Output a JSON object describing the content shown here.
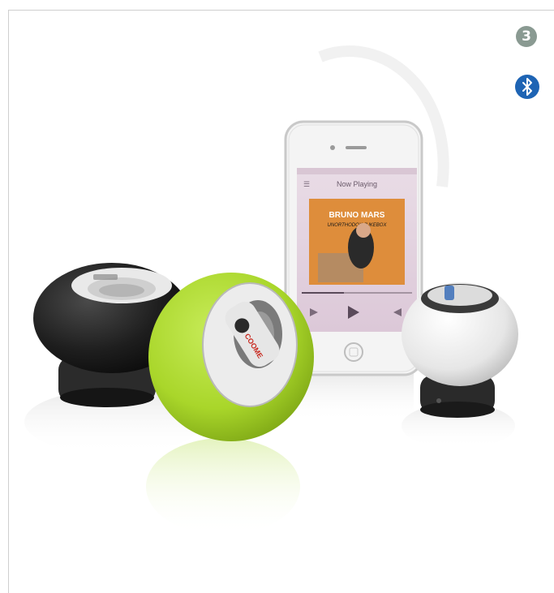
{
  "badge": {
    "number": "3",
    "icon": "bluetooth-icon",
    "color": "#1e64b4"
  },
  "phone": {
    "screen_title": "Now Playing",
    "album_artist": "BRUNO MARS",
    "album_title": "UNORTHODOX JUKEBOX"
  },
  "speakers": [
    {
      "color": "black"
    },
    {
      "color": "lime-green",
      "hex": "#a9d62a",
      "logo": "COOME"
    },
    {
      "color": "white"
    }
  ]
}
